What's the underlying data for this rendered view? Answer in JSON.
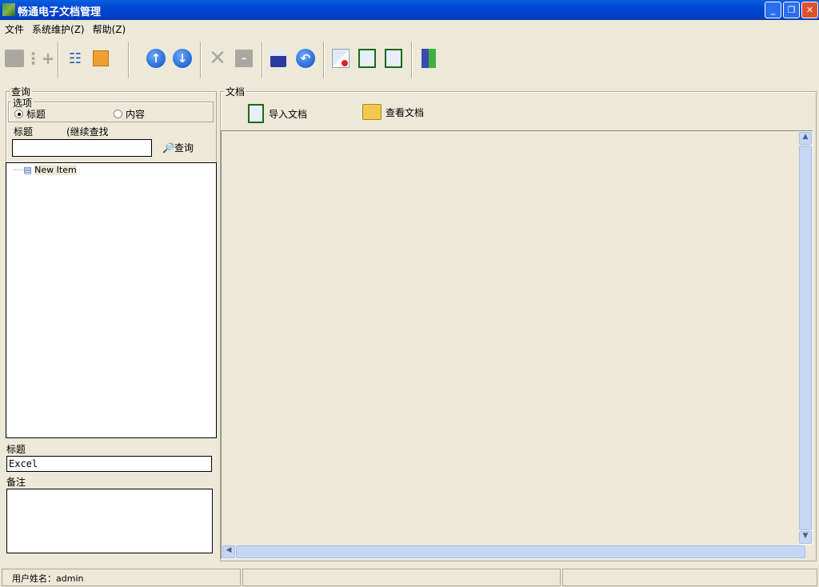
{
  "window": {
    "title": "畅通电子文档管理",
    "minimize": "_",
    "restore": "❐",
    "close": "✕"
  },
  "menu": [
    "文件",
    "系统维护(Z)",
    "帮助(Z)"
  ],
  "toolbar": {
    "icons": [
      "add-node-icon",
      "add-child-icon",
      "tree-align-icon",
      "move-node-icon",
      "up-arrow-icon",
      "down-arrow-icon",
      "delete-icon",
      "edit-icon",
      "save-icon",
      "undo-icon",
      "transfer-icon",
      "import-doc-icon",
      "export-doc-icon",
      "exit-door-icon"
    ]
  },
  "query": {
    "group_label": "查询",
    "options_label": "选项",
    "opt_title": "标题",
    "opt_content": "内容",
    "title_label": "标题",
    "continue_label": "(继续查找 F",
    "search_value": "",
    "search_button": "查询"
  },
  "tree": {
    "items": [
      "New Item"
    ]
  },
  "details": {
    "title_label": "标题",
    "title_value": "Excel",
    "note_label": "备注",
    "note_value": ""
  },
  "docs": {
    "group_label": "文档",
    "import_button": "导入文档",
    "view_button": "查看文档"
  },
  "status": {
    "user": "用户姓名：admin",
    "cell2": "",
    "cell3": ""
  }
}
